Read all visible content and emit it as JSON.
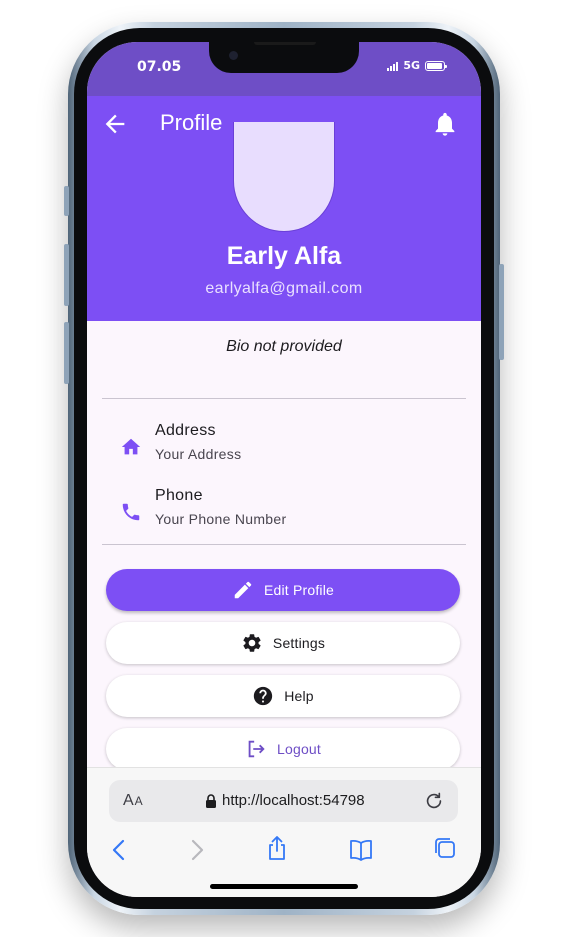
{
  "status_bar": {
    "time": "07.05",
    "network": "5G"
  },
  "app_bar": {
    "title": "Profile"
  },
  "profile": {
    "name": "Early Alfa",
    "email": "earlyalfa@gmail.com",
    "bio": "Bio not provided"
  },
  "info": {
    "address": {
      "title": "Address",
      "value": "Your Address"
    },
    "phone": {
      "title": "Phone",
      "value": "Your Phone Number"
    }
  },
  "actions": {
    "edit_profile": "Edit Profile",
    "settings": "Settings",
    "help": "Help",
    "logout": "Logout"
  },
  "browser": {
    "aa_big": "A",
    "aa_small": "A",
    "url": "http://localhost:54798"
  },
  "colors": {
    "primary": "#7d4ff4",
    "status_bar": "#6e4ec6",
    "avatar_fill": "#e8ddfe",
    "background": "#fcf6fd"
  },
  "icons": {
    "back": "arrow-left-icon",
    "notifications": "bell-icon",
    "address": "home-icon",
    "phone": "phone-icon",
    "edit": "pencil-icon",
    "settings": "gear-icon",
    "help": "help-circle-icon",
    "logout": "logout-icon"
  }
}
